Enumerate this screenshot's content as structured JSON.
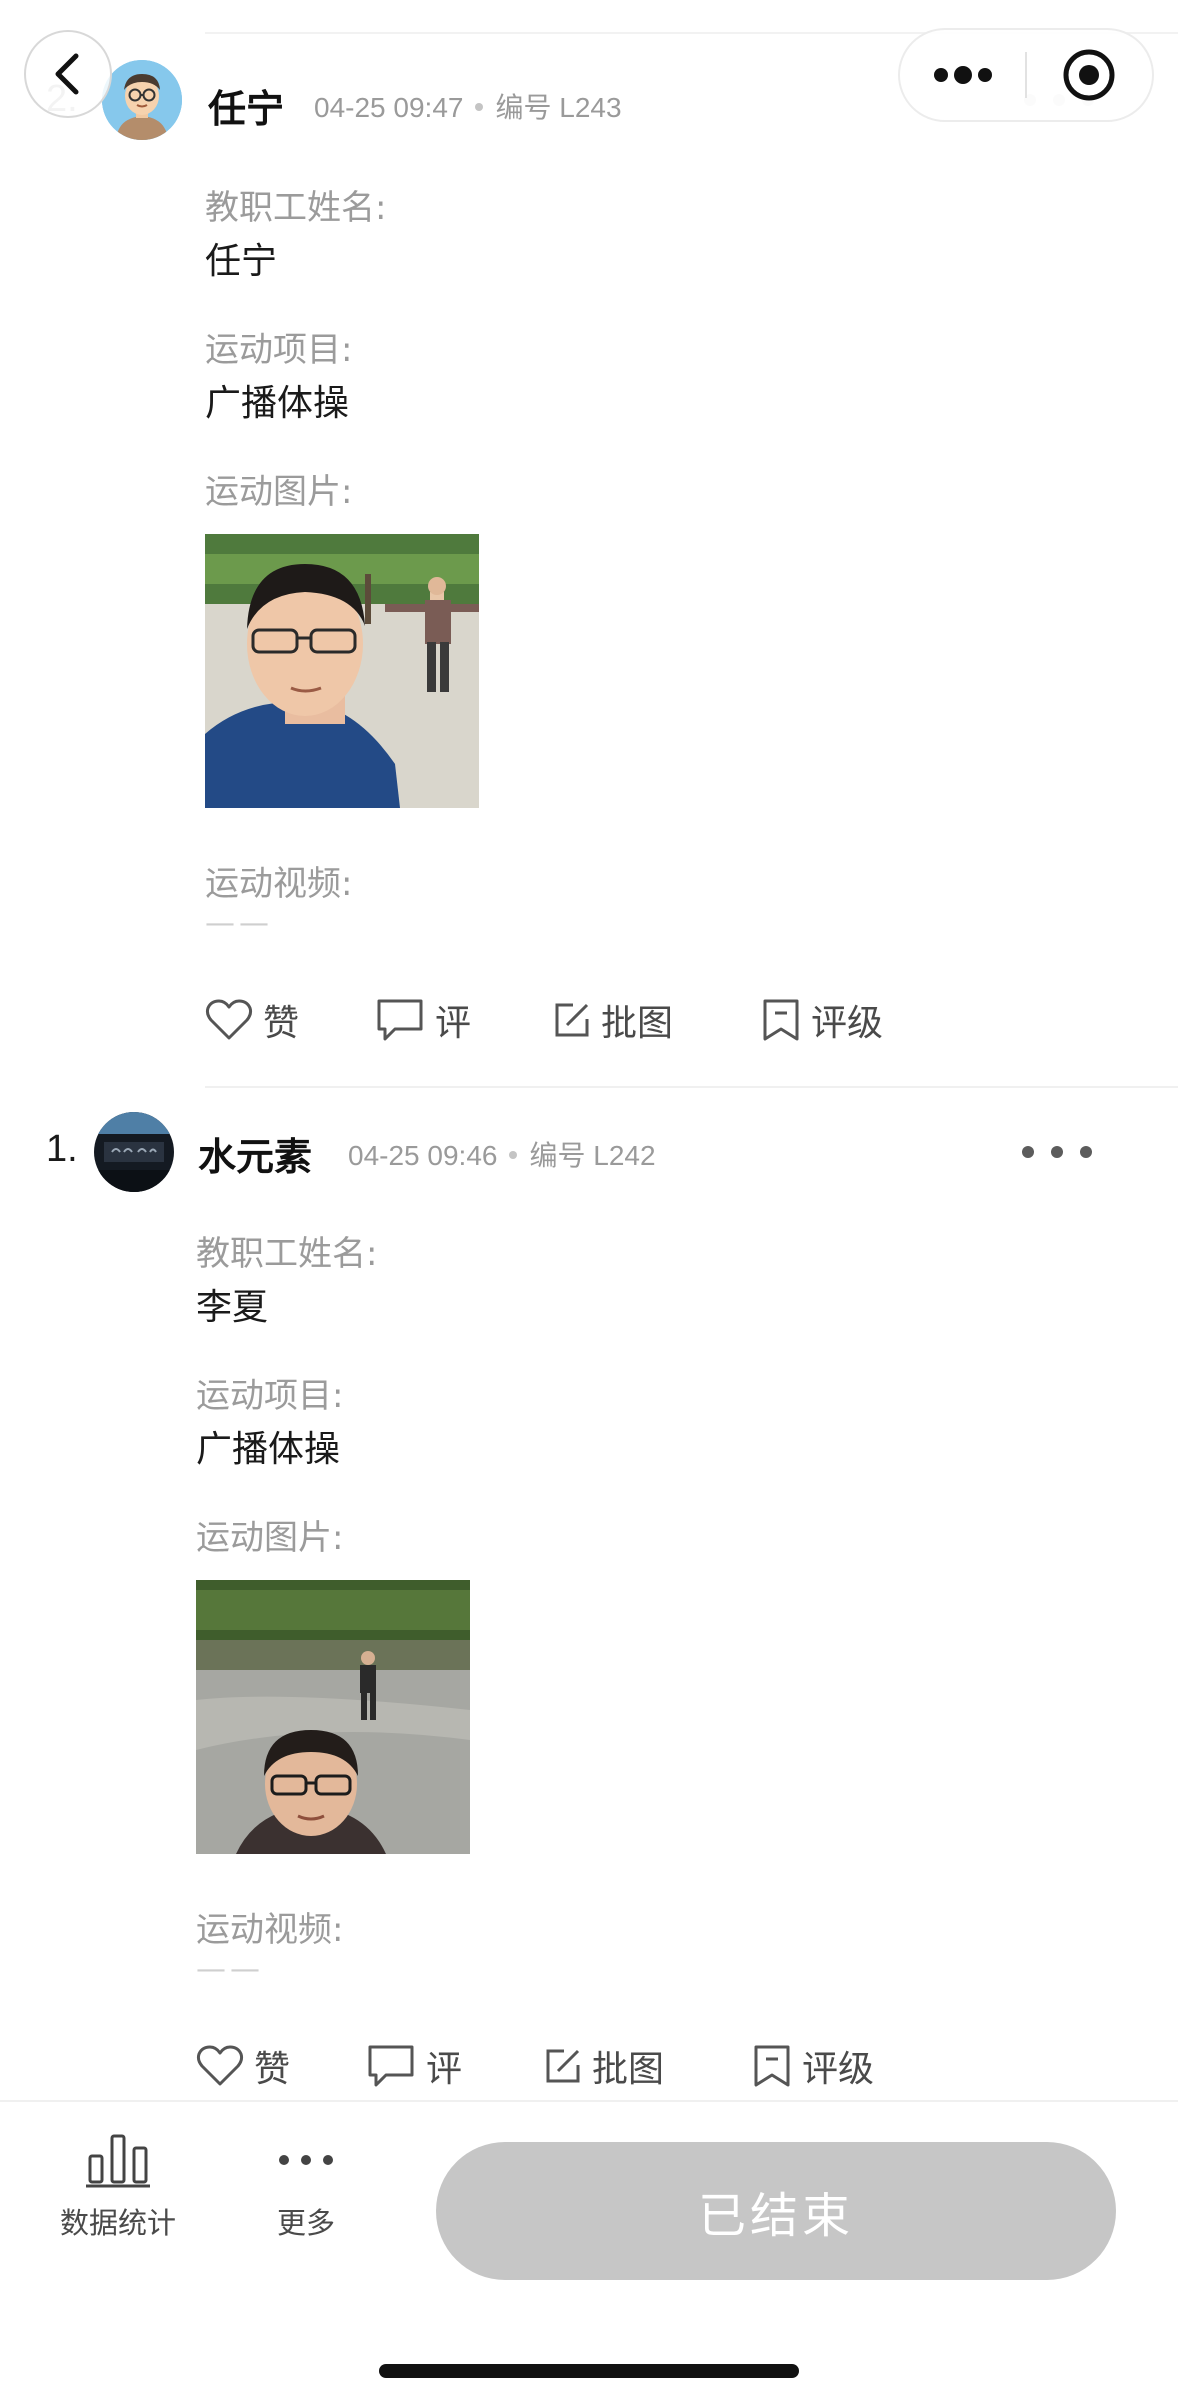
{
  "nav": {
    "back_icon": "chevron-left-icon",
    "menu_icon": "more-dots-icon",
    "target_icon": "record-target-icon"
  },
  "posts": [
    {
      "rank": "2.",
      "username": "任宁",
      "time": "04-25 09:47",
      "code": "编号 L243",
      "fields": [
        {
          "label": "教职工姓名:",
          "value": "任宁"
        },
        {
          "label": "运动项目:",
          "value": "广播体操"
        },
        {
          "label": "运动图片:",
          "value": ""
        },
        {
          "label": "运动视频:",
          "value": "——"
        }
      ]
    },
    {
      "rank": "1.",
      "username": "水元素",
      "time": "04-25 09:46",
      "code": "编号 L242",
      "fields": [
        {
          "label": "教职工姓名:",
          "value": "李夏"
        },
        {
          "label": "运动项目:",
          "value": "广播体操"
        },
        {
          "label": "运动图片:",
          "value": ""
        },
        {
          "label": "运动视频:",
          "value": "——"
        }
      ]
    }
  ],
  "actions": {
    "like": "赞",
    "comment": "评",
    "annotate": "批图",
    "rate": "评级"
  },
  "bottom": {
    "stats": "数据统计",
    "more": "更多",
    "ended": "已结束"
  },
  "colors": {
    "disabled_button": "#c6c6c6",
    "muted_text": "#9b9b9b",
    "body_text": "#1a1a1a"
  }
}
